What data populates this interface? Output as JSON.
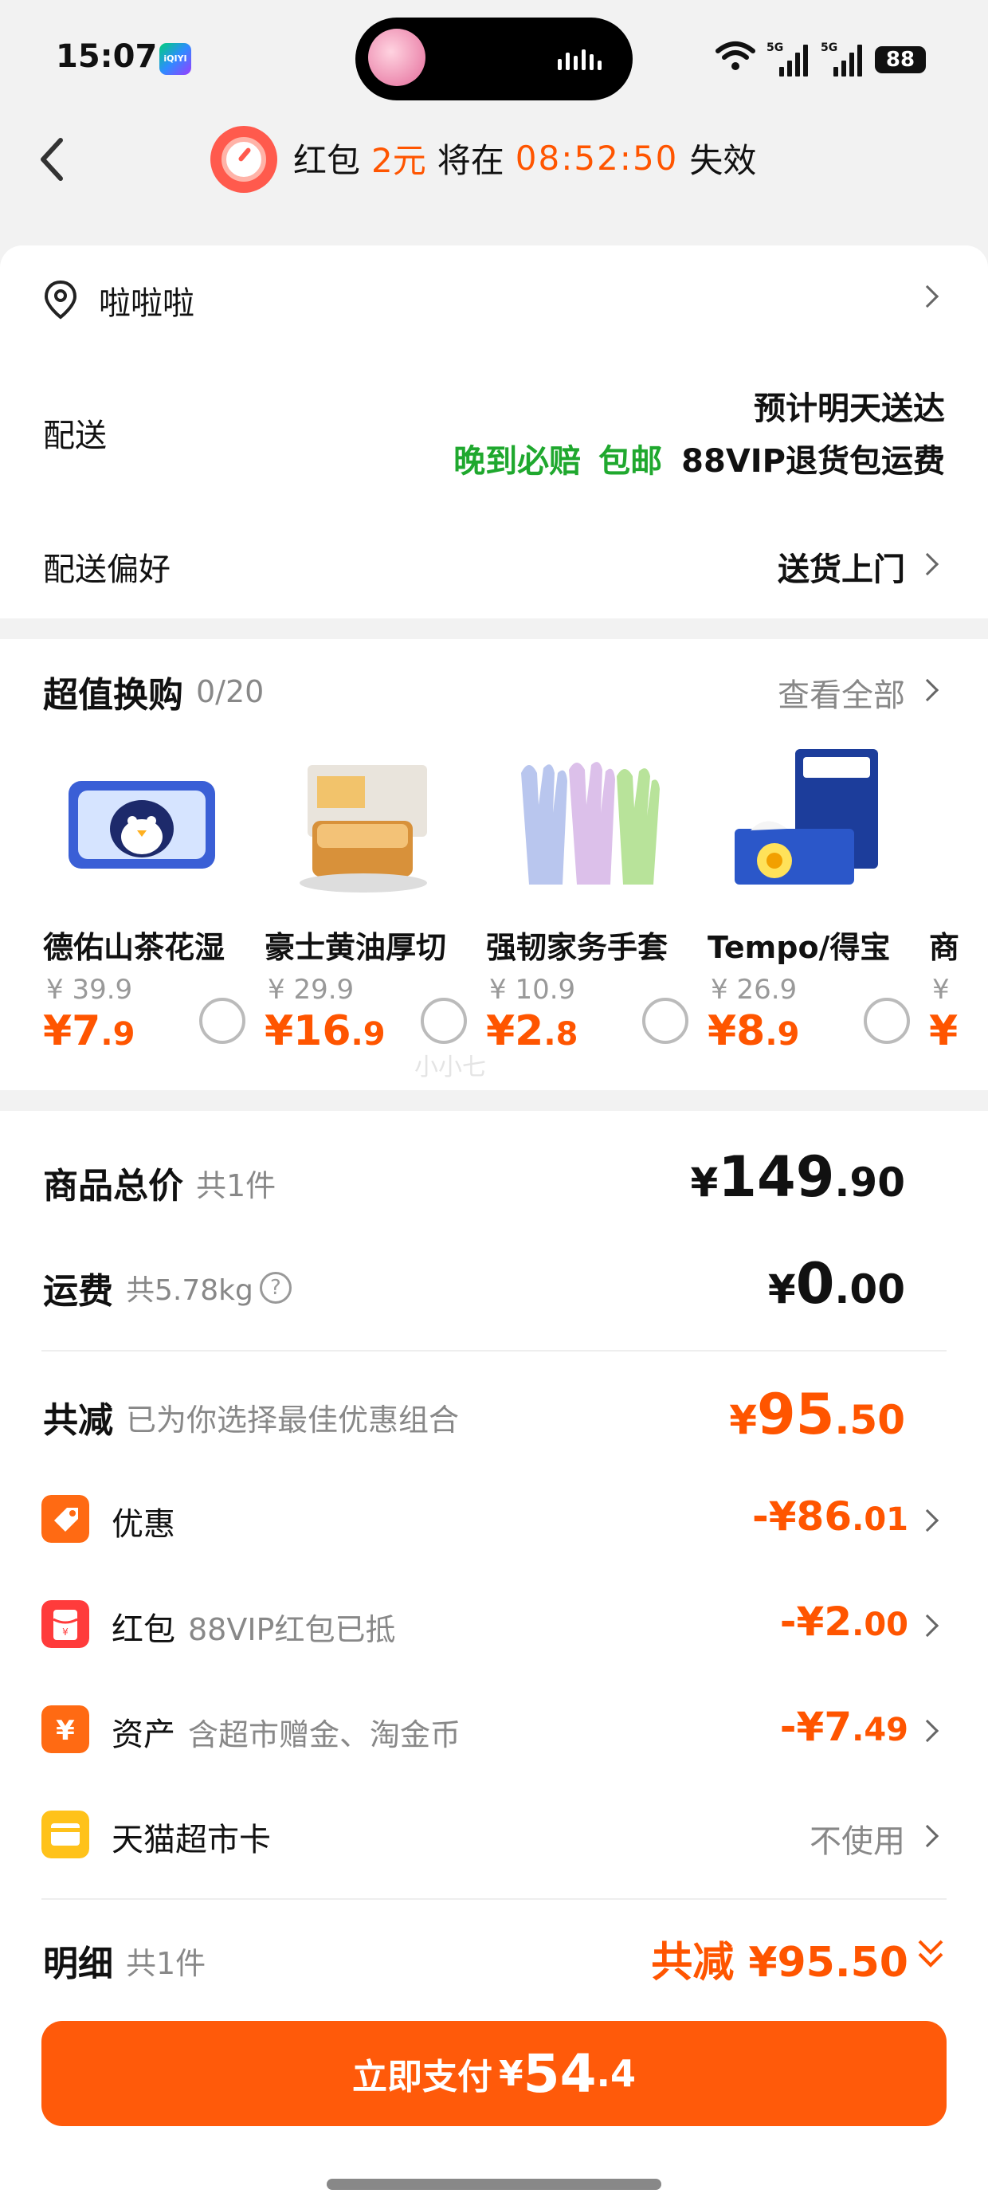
{
  "status_bar": {
    "time": "15:07",
    "app_badge": "iQIYI",
    "network": "5G",
    "battery": "88"
  },
  "header": {
    "label_redpacket": "红包",
    "amount": "2元",
    "will_at": "将在",
    "countdown": "08:52:50",
    "expire": "失效"
  },
  "address": {
    "name": "啦啦啦"
  },
  "delivery": {
    "label": "配送",
    "eta": "预计明天送达",
    "badges": [
      "晚到必赔",
      "包邮"
    ],
    "return_note": "88VIP退货包运费",
    "pref_label": "配送偏好",
    "pref_value": "送货上门"
  },
  "swap": {
    "title": "超值换购",
    "count": "0/20",
    "view_all": "查看全部",
    "watermark": "小小七",
    "items": [
      {
        "name": "德佑山茶花湿",
        "old_price": "¥ 39.9",
        "price_int": "¥7",
        "price_dec": ".9"
      },
      {
        "name": "豪士黄油厚切",
        "old_price": "¥ 29.9",
        "price_int": "¥16",
        "price_dec": ".9"
      },
      {
        "name": "强韧家务手套",
        "old_price": "¥ 10.9",
        "price_int": "¥2",
        "price_dec": ".8"
      },
      {
        "name": "Tempo/得宝",
        "old_price": "¥ 26.9",
        "price_int": "¥8",
        "price_dec": ".9"
      },
      {
        "name": "商",
        "old_price": "¥",
        "price_int": "¥",
        "price_dec": ""
      }
    ]
  },
  "summary": {
    "goods_label": "商品总价",
    "goods_count": "共1件",
    "goods_yen": "¥",
    "goods_int": "149",
    "goods_dec": ".90",
    "ship_label": "运费",
    "ship_weight": "共5.78kg",
    "ship_yen": "¥",
    "ship_int": "0",
    "ship_dec": ".00",
    "reduce_label": "共减",
    "reduce_note": "已为你选择最佳优惠组合",
    "reduce_yen": "¥",
    "reduce_int": "95",
    "reduce_dec": ".50"
  },
  "discounts": [
    {
      "label": "优惠",
      "note": "",
      "value_int": "-¥86",
      "value_dec": ".01"
    },
    {
      "label": "红包",
      "note": "88VIP红包已抵",
      "value_int": "-¥2",
      "value_dec": ".00"
    },
    {
      "label": "资产",
      "note": "含超市赠金、淘金币",
      "value_int": "-¥7",
      "value_dec": ".49"
    },
    {
      "label": "天猫超市卡",
      "note": "",
      "value_text": "不使用"
    }
  ],
  "detail": {
    "label": "明细",
    "count": "共1件",
    "reduce": "共减 ¥95.50"
  },
  "pay": {
    "label": "立即支付",
    "yen": "¥",
    "int": "54",
    "dec": ".4"
  },
  "colors": {
    "accent": "#ff5500",
    "green": "#1fa82e",
    "button": "#ff5a0a"
  }
}
